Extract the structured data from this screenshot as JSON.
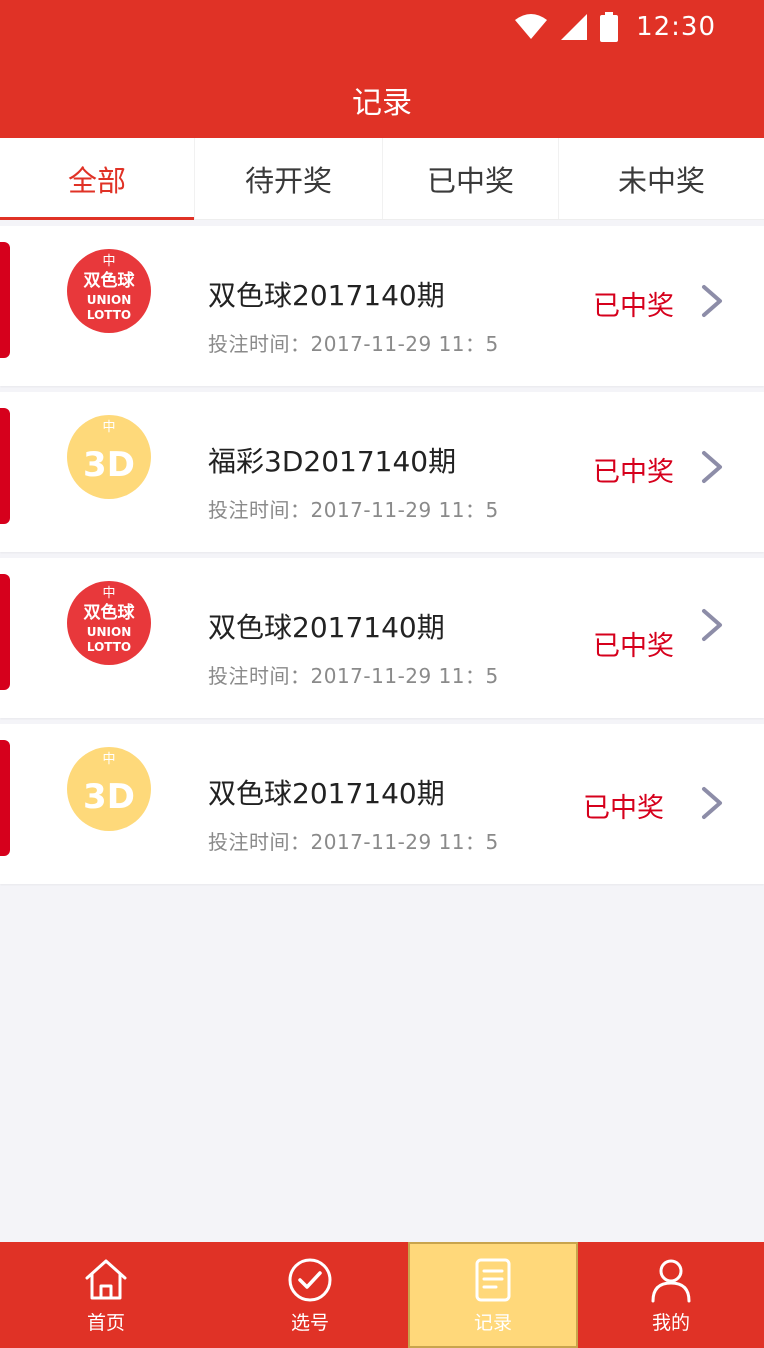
{
  "status_bar": {
    "time": "12:30"
  },
  "header": {
    "title": "记录"
  },
  "tabs": [
    {
      "label": "全部"
    },
    {
      "label": "待开奖"
    },
    {
      "label": "已中奖"
    },
    {
      "label": "未中奖"
    }
  ],
  "records": [
    {
      "logo": "union-lotto-logo",
      "name": "双色球2017140期",
      "time": "投注时间：2017-11-29  11：5",
      "status": "已中奖"
    },
    {
      "logo": "fucai-3d-logo",
      "name": "福彩3D2017140期",
      "time": "投注时间：2017-11-29  11：5",
      "status": "已中奖"
    },
    {
      "logo": "union-lotto-logo",
      "name": "双色球2017140期",
      "time": "投注时间：2017-11-29  11：5",
      "status": "已中奖"
    },
    {
      "logo": "fucai-3d-logo",
      "name": "双色球2017140期",
      "time": "投注时间：2017-11-29  11：5",
      "status": "已中奖"
    }
  ],
  "bottom_nav": [
    {
      "label": "首页",
      "icon": "home-icon"
    },
    {
      "label": "选号",
      "icon": "check-circle-icon"
    },
    {
      "label": "记录",
      "icon": "record-icon"
    },
    {
      "label": "我的",
      "icon": "user-icon"
    }
  ],
  "colors": {
    "primary": "#e03226",
    "accent": "#d6001c",
    "nav_active": "#ffd87a",
    "logo_yellow": "#fed97a"
  }
}
